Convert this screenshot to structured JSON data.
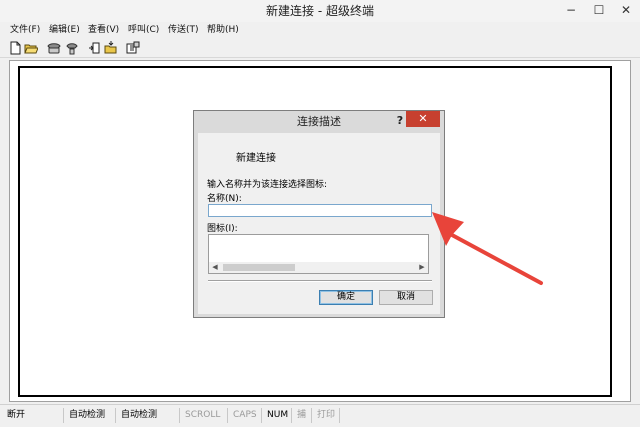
{
  "window": {
    "title": "新建连接 - 超级终端",
    "controls": {
      "minimize": "−",
      "maximize": "☐",
      "close": "✕"
    }
  },
  "menu": [
    "文件(F)",
    "编辑(E)",
    "查看(V)",
    "呼叫(C)",
    "传送(T)",
    "帮助(H)"
  ],
  "toolbar_icons": [
    "new-file-icon",
    "open-folder-icon",
    "phone-icon",
    "disconnect-icon",
    "send-file-icon",
    "receive-file-icon",
    "properties-icon"
  ],
  "dialog": {
    "title": "连接描述",
    "help": "?",
    "close": "✕",
    "connection_name": "新建连接",
    "prompt": "输入名称并为该连接选择图标:",
    "name_label": "名称(N):",
    "name_value": "",
    "icon_label": "图标(I):",
    "scroll_left": "◀",
    "scroll_right": "▶",
    "ok": "确定",
    "cancel": "取消"
  },
  "status": [
    "断开",
    "自动检测",
    "自动检测",
    "SCROLL",
    "CAPS",
    "NUM",
    "捕",
    "打印"
  ],
  "colors": {
    "close_red": "#c7402f",
    "arrow_red": "#e8443a",
    "input_border": "#7aa7cd"
  }
}
